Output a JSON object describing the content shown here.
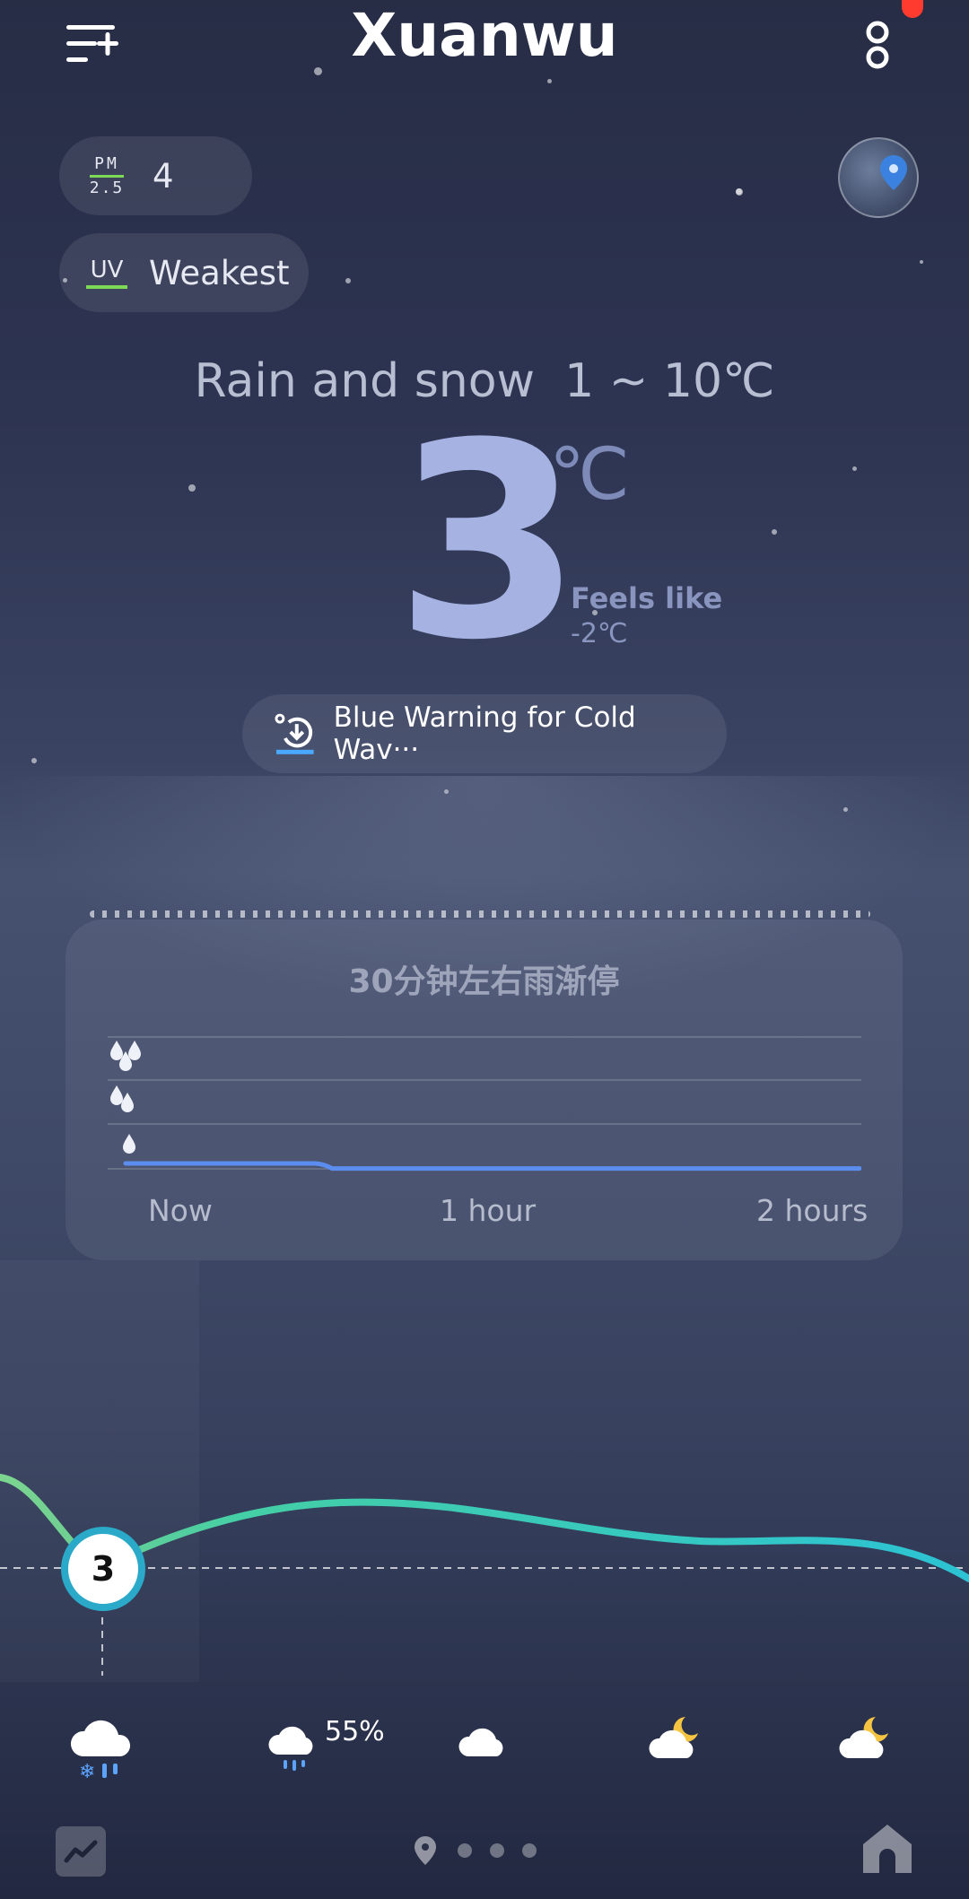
{
  "header": {
    "city": "Xuanwu"
  },
  "air": {
    "pm_label_top": "PM",
    "pm_label_bottom": "2.5",
    "pm_value": "4",
    "uv_label": "UV",
    "uv_value": "Weakest"
  },
  "current": {
    "condition_range": "Rain and snow  1 ~ 10℃",
    "temp": "3",
    "unit": "℃",
    "feels_like_label": "Feels like",
    "feels_like_value": "-2℃",
    "warning": "Blue Warning for Cold Wav···"
  },
  "precip_card": {
    "title": "30分钟左右雨渐停",
    "x_labels": [
      "Now",
      "1 hour",
      "2 hours"
    ],
    "chart_data": {
      "type": "line",
      "x": [
        "Now",
        "1 hour",
        "2 hours"
      ],
      "ylevels": [
        "light",
        "moderate",
        "heavy"
      ],
      "series": [
        {
          "values": [
            0.25,
            0.05,
            0.05
          ]
        }
      ]
    }
  },
  "hourly": {
    "current_temp": "3",
    "precip_prob": "55%",
    "icons": [
      "rain-snow-icon",
      "rain-icon",
      "cloud-icon",
      "partly-cloudy-night-icon",
      "partly-cloudy-night-icon"
    ]
  },
  "colors": {
    "accent_blue": "#5b8def",
    "curve_green": "#7bd68f",
    "curve_teal": "#2cc3d4",
    "notification": "#ff3b30"
  }
}
